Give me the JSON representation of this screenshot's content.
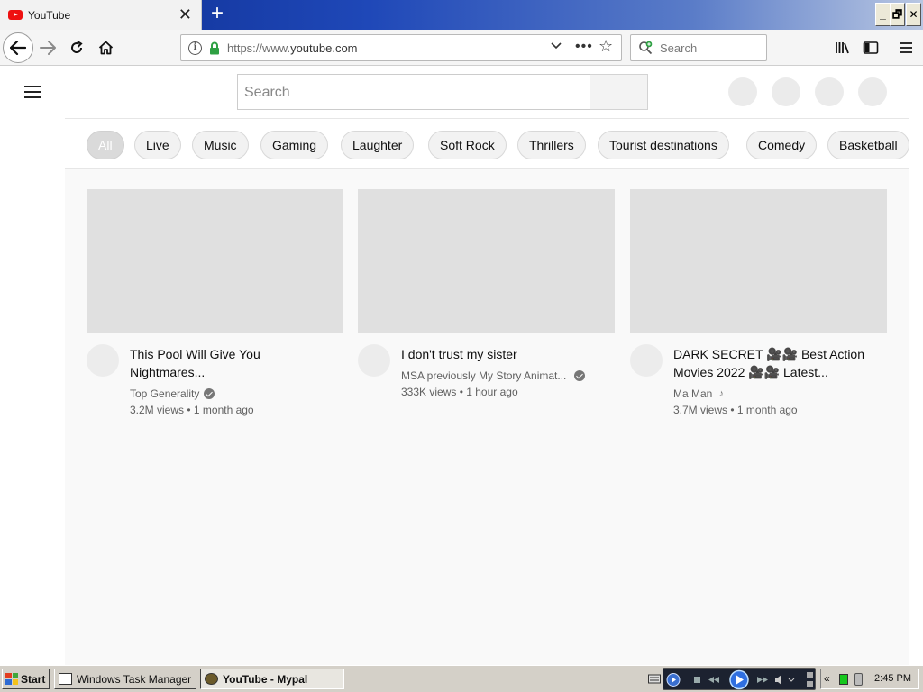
{
  "browser": {
    "tab_title": "YouTube",
    "tab_close": "✕",
    "new_tab": "+",
    "url_prefix": "https://www.",
    "url_domain": "youtube.com",
    "url_dots": "•••",
    "search_placeholder": "Search",
    "window_controls": [
      "_",
      "🗗",
      "✕"
    ]
  },
  "page": {
    "search_placeholder": "Search",
    "chips": [
      "All",
      "Live",
      "Music",
      "Gaming",
      "Laughter",
      "Soft Rock",
      "Thrillers",
      "Tourist destinations",
      "Comedy",
      "Basketball"
    ],
    "videos": [
      {
        "title": "This Pool Will Give You Nightmares...",
        "channel": "Top Generality",
        "badge": "verified",
        "meta": "3.2M views • 1 month ago"
      },
      {
        "title": "I don't trust my sister",
        "channel": "MSA previously My Story Animat...",
        "badge": "verified",
        "meta": "333K views • 1 hour ago"
      },
      {
        "title": "DARK SECRET 🎥🎥 Best Action Movies 2022 🎥🎥 Latest...",
        "channel": "Ma Man",
        "badge": "music-note",
        "meta": "3.7M views • 1 month ago"
      }
    ]
  },
  "taskbar": {
    "start_label": "Start",
    "tasks": [
      {
        "label": "Windows Task Manager",
        "active": false
      },
      {
        "label": "YouTube - Mypal",
        "active": true
      }
    ],
    "tray_chevron": "«",
    "clock": "2:45 PM"
  },
  "colors": {
    "titlebar_start": "#0b2a8c",
    "lock_green": "#2ea043",
    "youtube_red": "#ee1111",
    "feed_bg": "#f9f9f9",
    "thumb_placeholder": "#e0e0e0"
  }
}
